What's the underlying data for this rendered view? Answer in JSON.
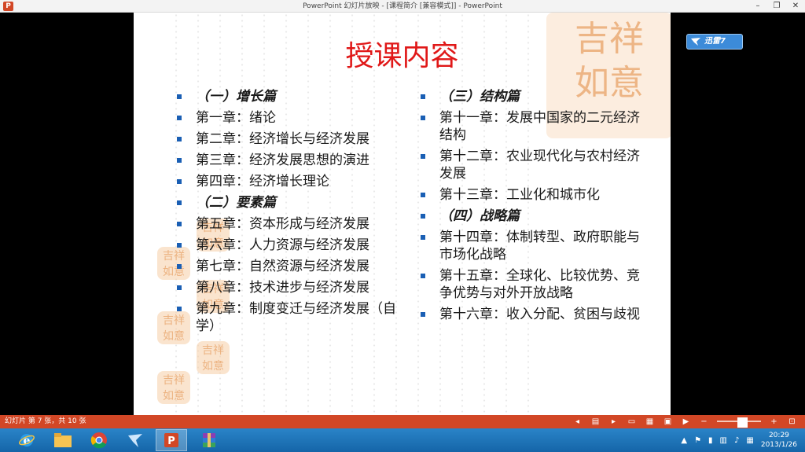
{
  "window": {
    "title": "PowerPoint 幻灯片放映 - [课程简介 [兼容模式]] - PowerPoint",
    "app_icon_letter": "P"
  },
  "slide": {
    "title": "授课内容",
    "left_column": [
      {
        "text": "（一）增长篇",
        "heading": true
      },
      {
        "text": "第一章：绪论"
      },
      {
        "text": "第二章：经济增长与经济发展"
      },
      {
        "text": "第三章：经济发展思想的演进"
      },
      {
        "text": "第四章：经济增长理论"
      },
      {
        "text": "（二）要素篇",
        "heading": true
      },
      {
        "text": "第五章：资本形成与经济发展"
      },
      {
        "text": "第六章：人力资源与经济发展"
      },
      {
        "text": "第七章：自然资源与经济发展"
      },
      {
        "text": "第八章：技术进步与经济发展"
      },
      {
        "text": "第九章：制度变迁与经济发展（自学）"
      }
    ],
    "right_column": [
      {
        "text": "（三）结构篇",
        "heading": true
      },
      {
        "text": "第十一章：发展中国家的二元经济结构"
      },
      {
        "text": "第十二章：农业现代化与农村经济发展"
      },
      {
        "text": "第十三章：工业化和城市化"
      },
      {
        "text": "（四）战略篇",
        "heading": true
      },
      {
        "text": "第十四章：体制转型、政府职能与市场化战略"
      },
      {
        "text": "第十五章：全球化、比较优势、竞争优势与对外开放战略"
      },
      {
        "text": "第十六章：收入分配、贫困与歧视"
      }
    ]
  },
  "xunlei": {
    "label": "迅雷7",
    "color": "#3c8bd9"
  },
  "statusbar": {
    "slide_info": "幻灯片 第 7 张，共 10 张",
    "color": "#d24726"
  },
  "taskbar": {
    "apps": [
      "ie-icon",
      "file-explorer-icon",
      "chrome-icon",
      "xunlei-icon",
      "powerpoint-icon",
      "winrar-icon"
    ],
    "clock_time": "20:29",
    "clock_date": "2013/1/26"
  }
}
